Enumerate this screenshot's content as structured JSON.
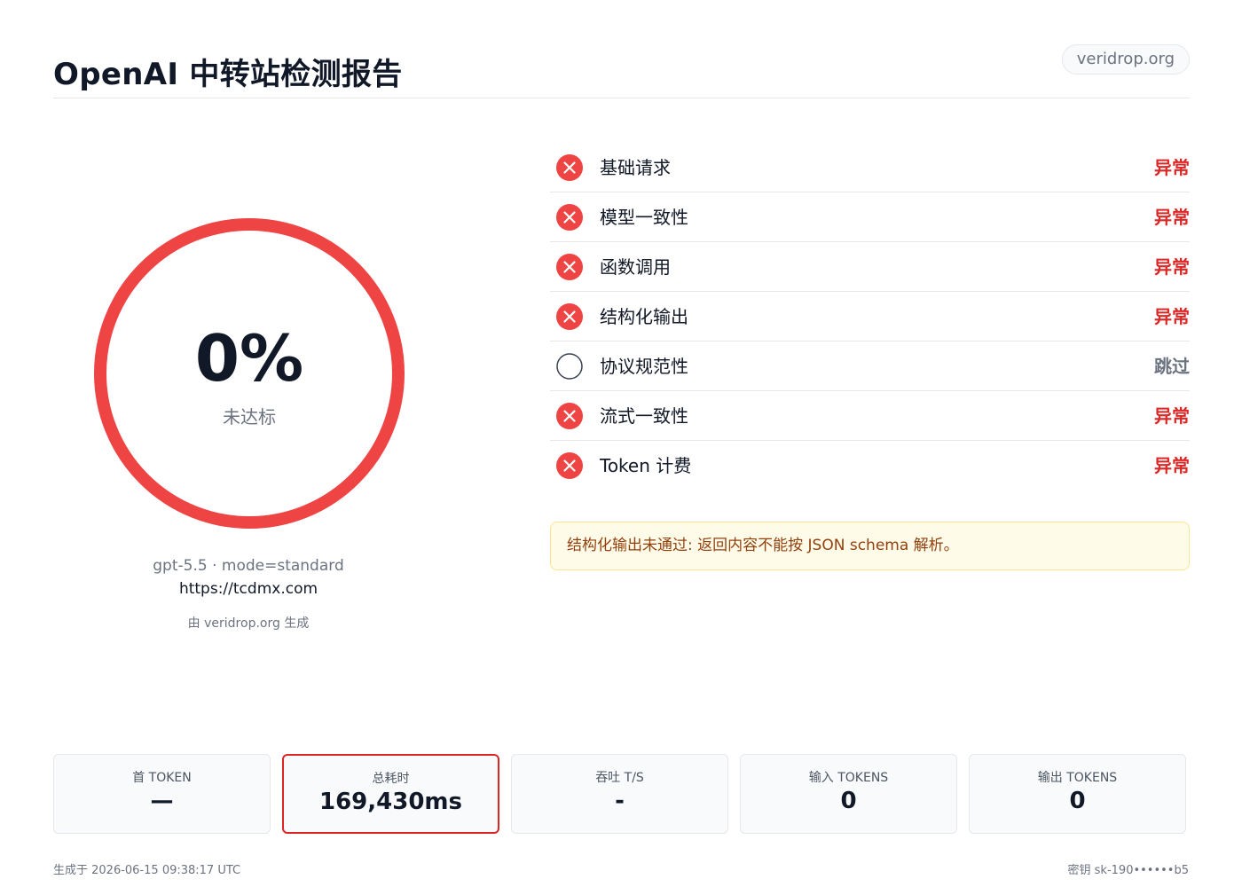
{
  "header": {
    "title": "OpenAI 中转站检测报告",
    "site_badge": "veridrop.org"
  },
  "score": {
    "value": "0%",
    "label": "未达标",
    "ring_color": "#ef4444",
    "progress": 0
  },
  "meta": {
    "model_line": "gpt-5.5 · mode=standard",
    "url": "https://tcdmx.com",
    "generated_by": "由 veridrop.org 生成"
  },
  "checks": [
    {
      "name": "基础请求",
      "status": "异常",
      "state": "fail"
    },
    {
      "name": "模型一致性",
      "status": "异常",
      "state": "fail"
    },
    {
      "name": "函数调用",
      "status": "异常",
      "state": "fail"
    },
    {
      "name": "结构化输出",
      "status": "异常",
      "state": "fail"
    },
    {
      "name": "协议规范性",
      "status": "跳过",
      "state": "skip"
    },
    {
      "name": "流式一致性",
      "status": "异常",
      "state": "fail"
    },
    {
      "name": "Token 计费",
      "status": "异常",
      "state": "fail"
    }
  ],
  "notice": "结构化输出未通过: 返回内容不能按 JSON schema 解析。",
  "stats": [
    {
      "label": "首 TOKEN",
      "value": "—"
    },
    {
      "label": "总耗时",
      "value": "169,430ms",
      "highlight": true
    },
    {
      "label": "吞吐 T/S",
      "value": "-"
    },
    {
      "label": "输入 TOKENS",
      "value": "0"
    },
    {
      "label": "输出 TOKENS",
      "value": "0"
    }
  ],
  "footer": {
    "generated_at": "生成于 2026-06-15 09:38:17 UTC",
    "key": "密钥 sk-190••••••b5"
  },
  "colors": {
    "fail": "#dc2626",
    "skip": "#6b7280",
    "notice_bg": "#fefce8",
    "notice_text": "#92400e"
  }
}
